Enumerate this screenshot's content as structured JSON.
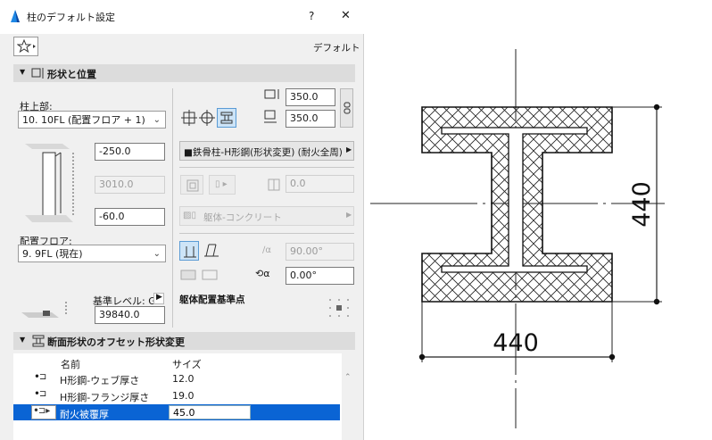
{
  "window": {
    "title": "柱のデフォルト設定",
    "help_label": "?",
    "close_label": "✕"
  },
  "toolbar": {
    "default_label": "デフォルト"
  },
  "section_shape": {
    "title": "形状と位置"
  },
  "top": {
    "label": "柱上部:",
    "value": "10. 10FL (配置フロア + 1)"
  },
  "offsets": {
    "top": "-250.0",
    "height": "3010.0",
    "bottom": "-60.0"
  },
  "floor": {
    "label": "配置フロア:",
    "value": "9. 9FL (現在)"
  },
  "reference": {
    "label": "基準レベル: GL",
    "value": "39840.0"
  },
  "size": {
    "width": "350.0",
    "depth": "350.0"
  },
  "profile": {
    "value": "■鉄骨柱-H形鋼(形状変更) (耐火全周)"
  },
  "misc": {
    "rotation_offset": "0.0",
    "core_material": "躯体-コンクリート",
    "slant_angle": "90.00°",
    "rotation_angle": "0.00°",
    "anchor_label": "躯体配置基準点"
  },
  "section_offset": {
    "title": "断面形状のオフセット形状変更"
  },
  "table": {
    "headers": [
      "名前",
      "サイズ"
    ],
    "rows": [
      {
        "name": "H形鋼-ウェブ厚さ",
        "size": "12.0"
      },
      {
        "name": "H形鋼-フランジ厚さ",
        "size": "19.0"
      },
      {
        "name": "耐火被覆厚",
        "size": "45.0"
      }
    ]
  },
  "drawing": {
    "dim_horizontal": "440",
    "dim_vertical": "440"
  },
  "colors": {
    "selection": "#0a64d4",
    "highlight_btn": "#cde4f7"
  }
}
